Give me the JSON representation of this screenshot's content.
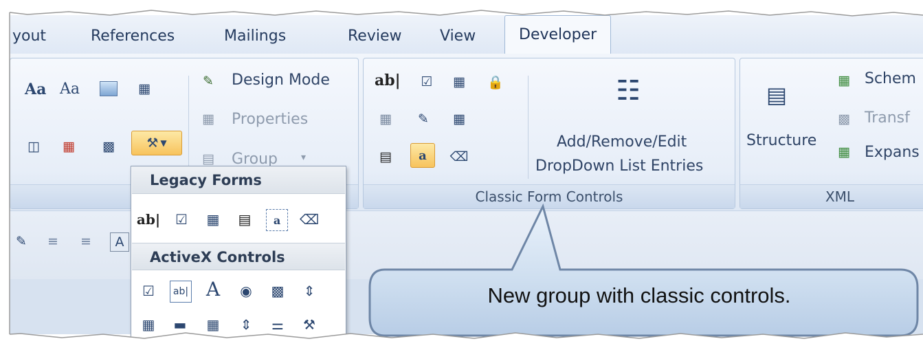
{
  "tabs": [
    {
      "label": "yout"
    },
    {
      "label": "References"
    },
    {
      "label": "Mailings"
    },
    {
      "label": "Review"
    },
    {
      "label": "View"
    },
    {
      "label": "Developer",
      "active": true
    }
  ],
  "controls_group": {
    "design_mode": "Design Mode",
    "properties": "Properties",
    "group": "Group",
    "group_arrow": "▾",
    "aa1": "Aa",
    "aa2": "Aa"
  },
  "classic_group": {
    "label": "Classic Form Controls",
    "ab_text": "ab|",
    "add_remove_line1": "Add/Remove/Edit",
    "add_remove_line2": "DropDown List Entries"
  },
  "xml_group": {
    "label": "XML",
    "structure": "Structure",
    "schema": "Schem",
    "transform": "Transf",
    "expansion": "Expans"
  },
  "dropdown": {
    "legacy_heading": "Legacy Forms",
    "activex_heading": "ActiveX Controls",
    "legacy_ab": "ab|",
    "activex_a": "A"
  },
  "callout": {
    "text": "New group with classic controls."
  },
  "colors": {
    "ribbon_bg": "#dfe8f4",
    "highlight": "#f7c35d",
    "group_border": "#b6c8df"
  }
}
